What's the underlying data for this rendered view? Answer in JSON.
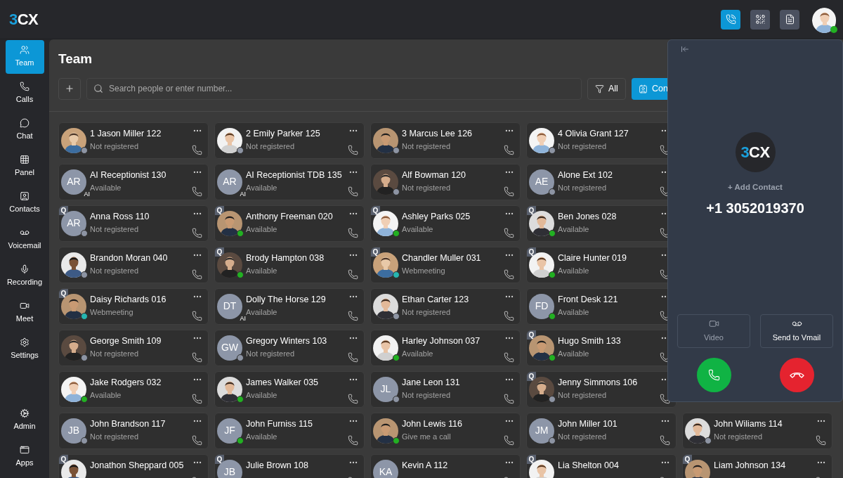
{
  "logo": {
    "accent": "3",
    "rest": "CX"
  },
  "sidebar": {
    "items": [
      {
        "label": "Team",
        "selected": true
      },
      {
        "label": "Calls",
        "selected": false
      },
      {
        "label": "Chat",
        "selected": false
      },
      {
        "label": "Panel",
        "selected": false
      },
      {
        "label": "Contacts",
        "selected": false
      },
      {
        "label": "Voicemail",
        "selected": false
      },
      {
        "label": "Recording",
        "selected": false
      },
      {
        "label": "Meet",
        "selected": false
      },
      {
        "label": "Settings",
        "selected": false
      }
    ],
    "bottom_items": [
      {
        "label": "Admin",
        "selected": false
      },
      {
        "label": "Apps",
        "selected": false
      }
    ]
  },
  "header": {
    "actions": [
      {
        "selected": true
      },
      {
        "selected": false
      },
      {
        "selected": false
      }
    ]
  },
  "page": {
    "title": "Team",
    "search": {
      "placeholder": "Search people or enter number..."
    },
    "filter": {
      "label": "All"
    },
    "contacts_button": {
      "label": "Con"
    }
  },
  "rows": [
    [
      {
        "name": "1 Jason Miller 122",
        "status": "Not registered",
        "color": "#8d94a3"
      },
      {
        "name": "2 Emily Parker 125",
        "status": "Not registered",
        "color": "#8d94a3"
      },
      {
        "name": "3 Marcus Lee 126",
        "status": "Not registered",
        "color": "#8d94a3"
      },
      {
        "name": "4 Olivia Grant 127",
        "status": "Not registered",
        "color": "#8d94a3"
      }
    ],
    [
      {
        "name": "AI Receptionist 130",
        "status": "Available",
        "avatar": {
          "kind": "initials",
          "text": "AR"
        },
        "ai": "AI"
      },
      {
        "name": "AI Receptionist TDB 135",
        "status": "Available",
        "avatar": {
          "kind": "initials",
          "text": "AR"
        },
        "ai": "AI"
      },
      {
        "name": "Alf Bowman 120",
        "status": "Not registered",
        "color": "#8d94a3"
      },
      {
        "name": "Alone Ext 102",
        "status": "Not registered",
        "avatar": {
          "kind": "initials",
          "text": "AE"
        },
        "color": "#8d94a3"
      }
    ],
    [
      {
        "name": "Anna Ross 110",
        "status": "Not registered",
        "avatar": {
          "kind": "initials",
          "text": "AR"
        },
        "color": "#8d94a3",
        "tag": "Q"
      },
      {
        "name": "Anthony Freeman 020",
        "status": "Available",
        "color": "#22b022",
        "tag": "Q"
      },
      {
        "name": "Ashley Parks 025",
        "status": "Available",
        "color": "#22b022",
        "tag": "Q"
      },
      {
        "name": "Ben Jones 028",
        "status": "Available",
        "color": "#22b022",
        "tag": "Q"
      }
    ],
    [
      {
        "name": "Brandon Moran 040",
        "status": "Not registered",
        "color": "#8d94a3"
      },
      {
        "name": "Brody Hampton 038",
        "status": "Available",
        "color": "#22b022",
        "tag": "Q"
      },
      {
        "name": "Chandler Muller 031",
        "status": "Webmeeting",
        "color": "#26b5b0",
        "tag": "Q"
      },
      {
        "name": "Claire Hunter 019",
        "status": "Available",
        "color": "#22b022",
        "tag": "Q"
      }
    ],
    [
      {
        "name": "Daisy Richards 016",
        "status": "Webmeeting",
        "color": "#26b5b0",
        "tag": "Q"
      },
      {
        "name": "Dolly The Horse 129",
        "status": "Available",
        "avatar": {
          "kind": "initials",
          "text": "DT"
        },
        "ai": "AI"
      },
      {
        "name": "Ethan Carter 123",
        "status": "Not registered",
        "color": "#8d94a3"
      },
      {
        "name": "Front Desk 121",
        "status": "Available",
        "avatar": {
          "kind": "initials",
          "text": "FD"
        },
        "color": "#22b022"
      }
    ],
    [
      {
        "name": "George Smith 109",
        "status": "Not registered",
        "color": "#8d94a3"
      },
      {
        "name": "Gregory Winters 103",
        "status": "Not registered",
        "avatar": {
          "kind": "initials",
          "text": "GW"
        },
        "color": "#8d94a3"
      },
      {
        "name": "Harley Johnson 037",
        "status": "Available",
        "color": "#22b022"
      },
      {
        "name": "Hugo Smith 133",
        "status": "Available",
        "color": "#22b022",
        "tag": "Q"
      }
    ],
    [
      {
        "name": "Jake Rodgers 032",
        "status": "Available",
        "color": "#22b022"
      },
      {
        "name": "James Walker 035",
        "status": "Available",
        "color": "#22b022"
      },
      {
        "name": "Jane Leon 131",
        "status": "Not registered",
        "avatar": {
          "kind": "initials",
          "text": "JL"
        },
        "color": "#8d94a3"
      },
      {
        "name": "Jenny Simmons 106",
        "status": "Not registered",
        "color": "#8d94a3",
        "tag": "Q"
      }
    ],
    [
      {
        "name": "John Brandson 117",
        "status": "Not registered",
        "avatar": {
          "kind": "initials",
          "text": "JB"
        },
        "color": "#8d94a3"
      },
      {
        "name": "John Furniss 115",
        "status": "Available",
        "avatar": {
          "kind": "initials",
          "text": "JF"
        },
        "color": "#22b022"
      },
      {
        "name": "John Lewis 116",
        "status": "Give me a call",
        "color": "#22b022"
      },
      {
        "name": "John Miller 101",
        "status": "Not registered",
        "avatar": {
          "kind": "initials",
          "text": "JM"
        },
        "color": "#8d94a3"
      },
      {
        "name": "John Wiliams 114",
        "status": "Not registered",
        "color": "#8d94a3"
      }
    ],
    [
      {
        "name": "Jonathon Sheppard 005",
        "tag": "Q"
      },
      {
        "name": "Julie Brown 108",
        "avatar": {
          "kind": "initials",
          "text": "JB"
        },
        "tag": "Q"
      },
      {
        "name": "Kevin A 112",
        "avatar": {
          "kind": "initials",
          "text": "KA"
        }
      },
      {
        "name": "Lia Shelton 004",
        "tag": "Q"
      },
      {
        "name": "Liam Johnson 134",
        "tag": "Q"
      }
    ]
  ],
  "call_panel": {
    "logo": {
      "accent": "3",
      "rest": "CX"
    },
    "add_contact": "+ Add Contact",
    "number": "+1 3052019370",
    "options": [
      {
        "label": "Video",
        "kind": "video",
        "disabled": true
      },
      {
        "label": "Send to Vmail",
        "kind": "voicemail",
        "disabled": false
      }
    ],
    "actions": [
      {
        "kind": "answer"
      },
      {
        "kind": "decline"
      }
    ]
  }
}
